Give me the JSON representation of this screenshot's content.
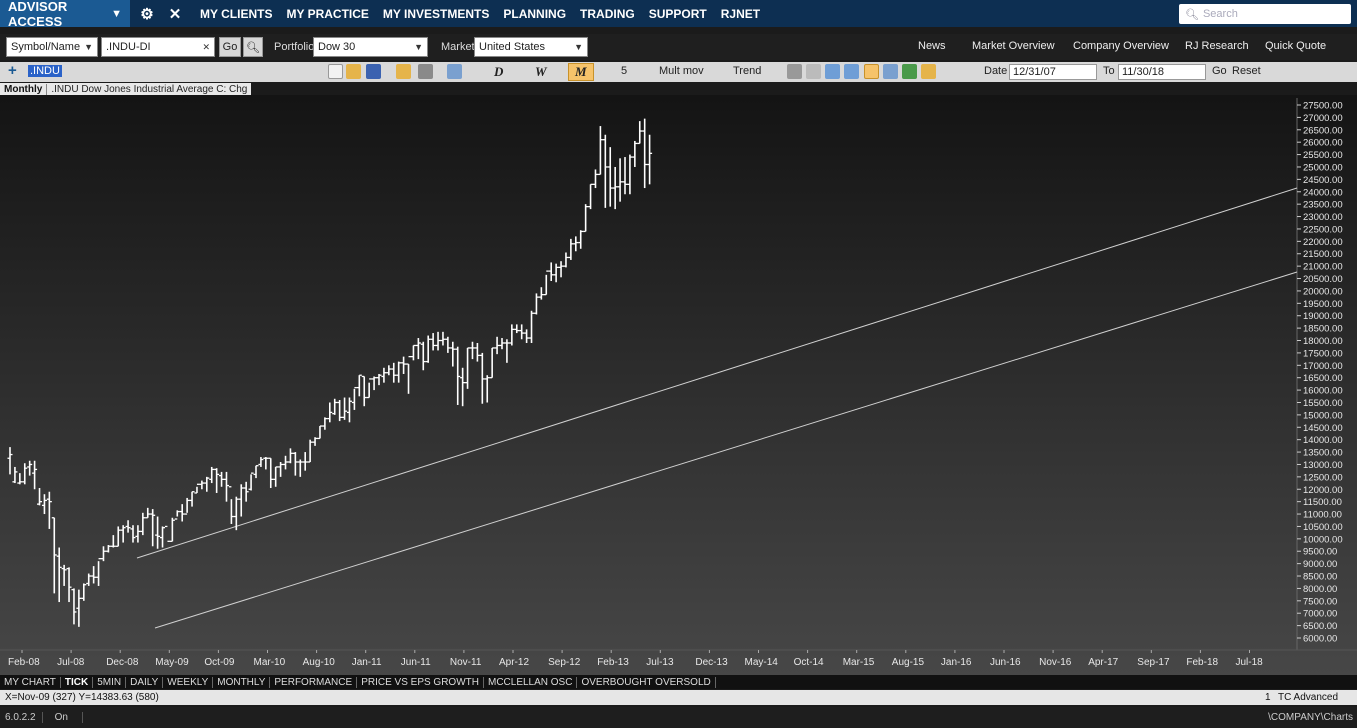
{
  "topnav": {
    "brand": "ADVISOR ACCESS",
    "brand_caret": "▼",
    "links": [
      "MY CLIENTS",
      "MY PRACTICE",
      "MY INVESTMENTS",
      "PLANNING",
      "TRADING",
      "SUPPORT",
      "RJNET"
    ],
    "search_placeholder": "Search"
  },
  "toolbar": {
    "symbol_type": "Symbol/Name",
    "symbol_value": ".INDU-DI",
    "clear": "✕",
    "go": "Go",
    "portfolio_label": "Portfolio",
    "portfolio_value": "Dow 30",
    "market_label": "Market",
    "market_value": "United States",
    "right_links": [
      "News",
      "Market Overview",
      "Company Overview",
      "RJ Research",
      "Quick Quote"
    ]
  },
  "charttools": {
    "symbol_chip": ".INDU",
    "period_d": "D",
    "period_w": "W",
    "period_m": "M",
    "count": "5",
    "mult_mov": "Mult mov",
    "trend": "Trend",
    "date_label": "Date",
    "date_from": "12/31/07",
    "to_label": "To",
    "date_to": "11/30/18",
    "go": "Go",
    "reset": "Reset"
  },
  "subtitle": {
    "period": "Monthly",
    "description": ".INDU  Dow Jones Industrial Average  C: Chg"
  },
  "chart_data": {
    "type": "ohlc",
    "period": "monthly",
    "ylim": [
      6000,
      27500
    ],
    "y_ticks": [
      6000,
      6500,
      7000,
      7500,
      8000,
      8500,
      9000,
      9500,
      10000,
      10500,
      11000,
      11500,
      12000,
      12500,
      13000,
      13500,
      14000,
      14500,
      15000,
      15500,
      16000,
      16500,
      17000,
      17500,
      18000,
      18500,
      19000,
      19500,
      20000,
      20500,
      21000,
      21500,
      22000,
      22500,
      23000,
      23500,
      24000,
      24500,
      25000,
      25500,
      26000,
      26500,
      27000,
      27500
    ],
    "x_labels": [
      "Feb-08",
      "Jul-08",
      "Dec-08",
      "May-09",
      "Oct-09",
      "Mar-10",
      "Aug-10",
      "Jan-11",
      "Jun-11",
      "Nov-11",
      "Apr-12",
      "Sep-12",
      "Feb-13",
      "Jul-13",
      "Dec-13",
      "May-14",
      "Oct-14",
      "Mar-15",
      "Aug-15",
      "Jan-16",
      "Jun-16",
      "Nov-16",
      "Apr-17",
      "Sep-17",
      "Feb-18",
      "Jul-18"
    ],
    "series": [
      {
        "values": [
          [
            13250,
            13700,
            13400,
            12600
          ],
          [
            12300,
            12900,
            12700,
            12250
          ],
          [
            12250,
            12650,
            12300,
            12200
          ],
          [
            12300,
            13050,
            12850,
            12200
          ],
          [
            12900,
            13150,
            13000,
            12550
          ],
          [
            12650,
            13150,
            12800,
            12000
          ],
          [
            11400,
            12050,
            11500,
            11350
          ],
          [
            11350,
            11800,
            11550,
            11000
          ],
          [
            11600,
            11900,
            11500,
            10400
          ],
          [
            10850,
            10850,
            9350,
            7800
          ],
          [
            9300,
            9650,
            8850,
            7450
          ],
          [
            8800,
            8950,
            8750,
            8100
          ],
          [
            8800,
            8850,
            8050,
            7450
          ],
          [
            7950,
            8000,
            7050,
            6550
          ],
          [
            7200,
            7950,
            7600,
            6450
          ],
          [
            7600,
            8200,
            8150,
            7500
          ],
          [
            8200,
            8600,
            8500,
            8100
          ],
          [
            8500,
            8900,
            8450,
            8200
          ],
          [
            8450,
            9100,
            9200,
            8100
          ],
          [
            9200,
            9700,
            9500,
            9100
          ],
          [
            9500,
            9750,
            9700,
            9450
          ],
          [
            9700,
            10150,
            9700,
            9650
          ],
          [
            9700,
            10500,
            10350,
            9700
          ],
          [
            10350,
            10550,
            10450,
            9850
          ],
          [
            10500,
            10750,
            10450,
            10250
          ],
          [
            10400,
            10550,
            10050,
            9850
          ],
          [
            10100,
            10550,
            10300,
            9850
          ],
          [
            10300,
            11050,
            10850,
            10150
          ],
          [
            10850,
            11250,
            11000,
            10850
          ],
          [
            11000,
            11200,
            10950,
            9700
          ],
          [
            10150,
            10900,
            10100,
            9600
          ],
          [
            10050,
            10500,
            10450,
            9650
          ],
          [
            10500,
            10450,
            9900,
            10450
          ],
          [
            9900,
            10850,
            10750,
            9900
          ],
          [
            10800,
            11150,
            11100,
            10900
          ],
          [
            11100,
            11400,
            11000,
            10700
          ],
          [
            11000,
            11650,
            11550,
            11050
          ],
          [
            11550,
            11900,
            11900,
            11300
          ],
          [
            11850,
            12100,
            12200,
            11850
          ],
          [
            12200,
            12350,
            12250,
            12000
          ],
          [
            12250,
            12500,
            12450,
            11900
          ],
          [
            12400,
            12900,
            12800,
            12250
          ],
          [
            12800,
            12850,
            12600,
            11850
          ],
          [
            12550,
            12700,
            12400,
            12100
          ],
          [
            12400,
            12700,
            12150,
            11500
          ],
          [
            12100,
            11600,
            10900,
            10600
          ],
          [
            10900,
            11700,
            11600,
            10350
          ],
          [
            11600,
            12200,
            12050,
            10900
          ],
          [
            12050,
            12300,
            11900,
            11500
          ],
          [
            12000,
            12600,
            12650,
            11950
          ],
          [
            12600,
            12950,
            12950,
            12450
          ],
          [
            13000,
            13300,
            13200,
            12900
          ],
          [
            13250,
            13300,
            13250,
            12800
          ],
          [
            13250,
            13250,
            12400,
            12050
          ],
          [
            12400,
            12900,
            12900,
            12100
          ],
          [
            12900,
            13100,
            13000,
            12500
          ],
          [
            13000,
            13350,
            13100,
            12800
          ],
          [
            13100,
            13650,
            13450,
            13050
          ],
          [
            13450,
            13500,
            13100,
            12550
          ],
          [
            13100,
            13200,
            13100,
            12500
          ],
          [
            13100,
            13500,
            13100,
            12750
          ],
          [
            13100,
            14000,
            13900,
            13100
          ],
          [
            13900,
            14100,
            14050,
            13750
          ],
          [
            14050,
            14550,
            14550,
            14050
          ],
          [
            14550,
            14900,
            14850,
            14400
          ],
          [
            14850,
            15500,
            15100,
            14700
          ],
          [
            15050,
            15650,
            15500,
            15000
          ],
          [
            15500,
            15600,
            14900,
            14750
          ],
          [
            14900,
            15700,
            15150,
            14800
          ],
          [
            15100,
            15700,
            15550,
            14700
          ],
          [
            15500,
            16050,
            16100,
            15200
          ],
          [
            16100,
            16600,
            16600,
            15750
          ],
          [
            16550,
            16550,
            15700,
            15350
          ],
          [
            15700,
            16300,
            16450,
            15700
          ],
          [
            16450,
            16550,
            16500,
            16000
          ],
          [
            16500,
            16650,
            16600,
            16200
          ],
          [
            16550,
            16900,
            16700,
            16300
          ],
          [
            16700,
            17000,
            16850,
            16600
          ],
          [
            16850,
            17100,
            16600,
            16300
          ],
          [
            16600,
            17150,
            17100,
            16300
          ],
          [
            17100,
            17350,
            17050,
            16650
          ],
          [
            17050,
            17050,
            17350,
            15850
          ],
          [
            17350,
            17800,
            17800,
            17200
          ],
          [
            17800,
            18100,
            17900,
            17250
          ],
          [
            17850,
            17950,
            17150,
            16800
          ],
          [
            17150,
            18200,
            18050,
            17100
          ],
          [
            18050,
            18300,
            17800,
            17600
          ],
          [
            17800,
            18350,
            18000,
            17600
          ],
          [
            18000,
            18350,
            18050,
            17800
          ],
          [
            18050,
            18150,
            17700,
            17500
          ],
          [
            17700,
            17950,
            17650,
            16950
          ],
          [
            17650,
            17750,
            16550,
            15400
          ],
          [
            16500,
            16900,
            16300,
            15350
          ],
          [
            16300,
            17700,
            17700,
            16050
          ],
          [
            17700,
            17950,
            17700,
            17250
          ],
          [
            17700,
            17900,
            17400,
            17150
          ],
          [
            17400,
            17500,
            16450,
            15450
          ],
          [
            16450,
            16600,
            16500,
            15500
          ],
          [
            16500,
            17700,
            17700,
            16500
          ],
          [
            17700,
            18150,
            17800,
            17450
          ],
          [
            17800,
            18100,
            17900,
            17650
          ],
          [
            17900,
            18050,
            17900,
            17100
          ],
          [
            17900,
            18650,
            18450,
            17800
          ],
          [
            18450,
            18650,
            18400,
            18300
          ],
          [
            18400,
            18650,
            18300,
            18050
          ],
          [
            18300,
            18450,
            18100,
            17900
          ],
          [
            18100,
            19200,
            19100,
            17900
          ],
          [
            19100,
            19900,
            19750,
            19050
          ],
          [
            19750,
            20150,
            19850,
            19650
          ],
          [
            19850,
            20650,
            20800,
            19850
          ],
          [
            20800,
            21150,
            20650,
            20400
          ],
          [
            20650,
            21100,
            20950,
            20350
          ],
          [
            20950,
            21200,
            21000,
            20550
          ],
          [
            21000,
            21550,
            21350,
            20950
          ],
          [
            21350,
            22100,
            21900,
            21250
          ],
          [
            21900,
            22200,
            21950,
            21600
          ],
          [
            21950,
            22450,
            22400,
            21700
          ],
          [
            22400,
            23500,
            23400,
            22400
          ],
          [
            23400,
            24300,
            24300,
            23300
          ],
          [
            24300,
            24900,
            24700,
            24150
          ],
          [
            24700,
            26650,
            26100,
            24700
          ],
          [
            26100,
            26300,
            25000,
            23350
          ],
          [
            25000,
            25800,
            24150,
            23400
          ],
          [
            24150,
            25000,
            24200,
            23300
          ],
          [
            24200,
            25350,
            24400,
            23600
          ],
          [
            24400,
            25400,
            24300,
            23900
          ],
          [
            24300,
            25500,
            25400,
            23900
          ],
          [
            25400,
            26050,
            25950,
            25000
          ],
          [
            25950,
            26850,
            26450,
            25950
          ],
          [
            26450,
            26950,
            25100,
            24150
          ],
          [
            25100,
            26300,
            25550,
            24300
          ]
        ]
      }
    ],
    "channel_label": "trend channel"
  },
  "bottom_tabs": [
    "MY CHART",
    "TICK",
    "5MIN",
    "DAILY",
    "WEEKLY",
    "MONTHLY",
    "PERFORMANCE",
    "PRICE VS EPS GROWTH",
    "MCCLELLAN OSC",
    "OVERBOUGHT OVERSOLD"
  ],
  "status": {
    "coords": "X=Nov-09 (327) Y=14383.63 (580)",
    "count": "1",
    "product": "TC Advanced",
    "version": "6.0.2.2",
    "mode": "On",
    "path": "\\COMPANY\\Charts"
  },
  "colors": {
    "nav_bg": "#0d2f52",
    "brand_bg": "#1b5a93",
    "bar": "#ffffff",
    "channel": "#d0d0d0"
  }
}
